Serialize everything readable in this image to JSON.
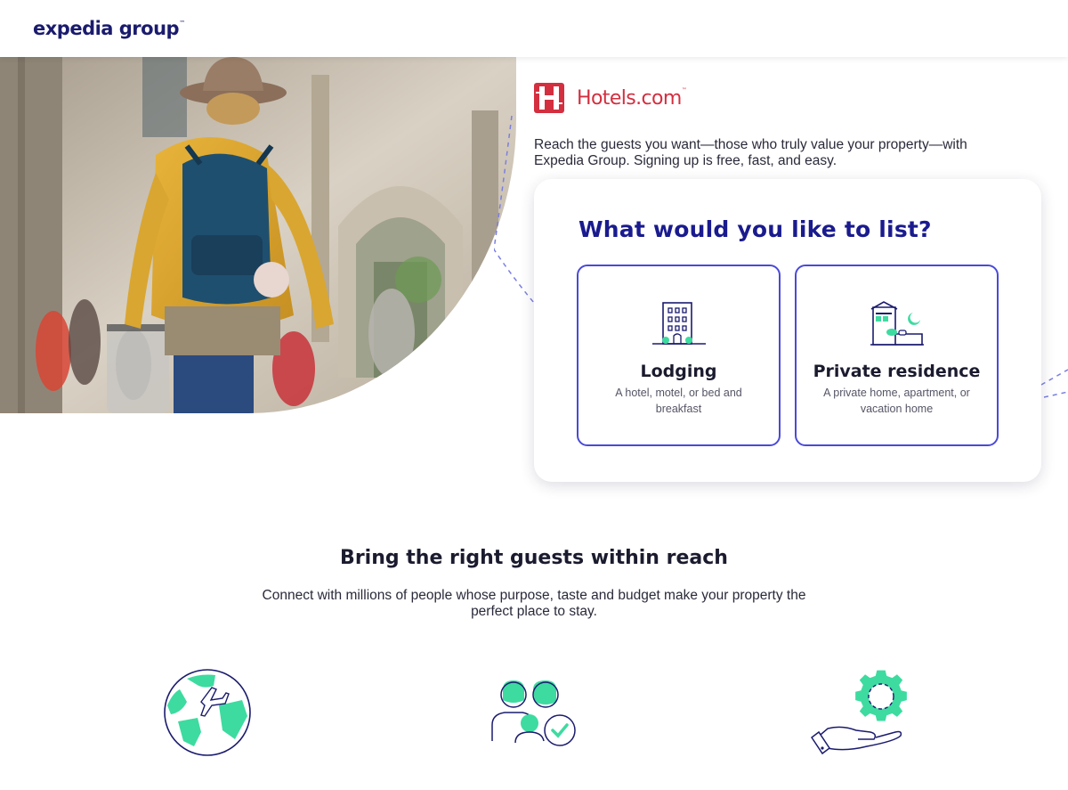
{
  "header": {
    "brand_name": "expedia group",
    "brand_tm": "™"
  },
  "hero": {
    "partner_name": "Hotels.com",
    "partner_tm": "™",
    "intro_text": "Reach the guests you want—those who truly value your property—with Expedia Group. Signing up is free, fast, and easy."
  },
  "list_card": {
    "title": "What would you like to list?",
    "options": [
      {
        "label": "Lodging",
        "description": "A hotel, motel, or bed and breakfast",
        "icon": "building-icon"
      },
      {
        "label": "Private residence",
        "description": "A private home, apartment, or vacation home",
        "icon": "house-icon"
      }
    ]
  },
  "reach_section": {
    "title": "Bring the right guests within reach",
    "subtitle": "Connect with millions of people whose purpose, taste and budget make your property the perfect place to stay.",
    "features": [
      {
        "icon": "globe-plane-icon"
      },
      {
        "icon": "people-check-icon"
      },
      {
        "icon": "hand-gear-icon"
      }
    ]
  },
  "colors": {
    "brand_navy": "#1a1b6e",
    "title_blue": "#1a1b8e",
    "option_border": "#4a4ad8",
    "accent_green": "#3ddba0",
    "partner_red": "#d32f3f"
  }
}
